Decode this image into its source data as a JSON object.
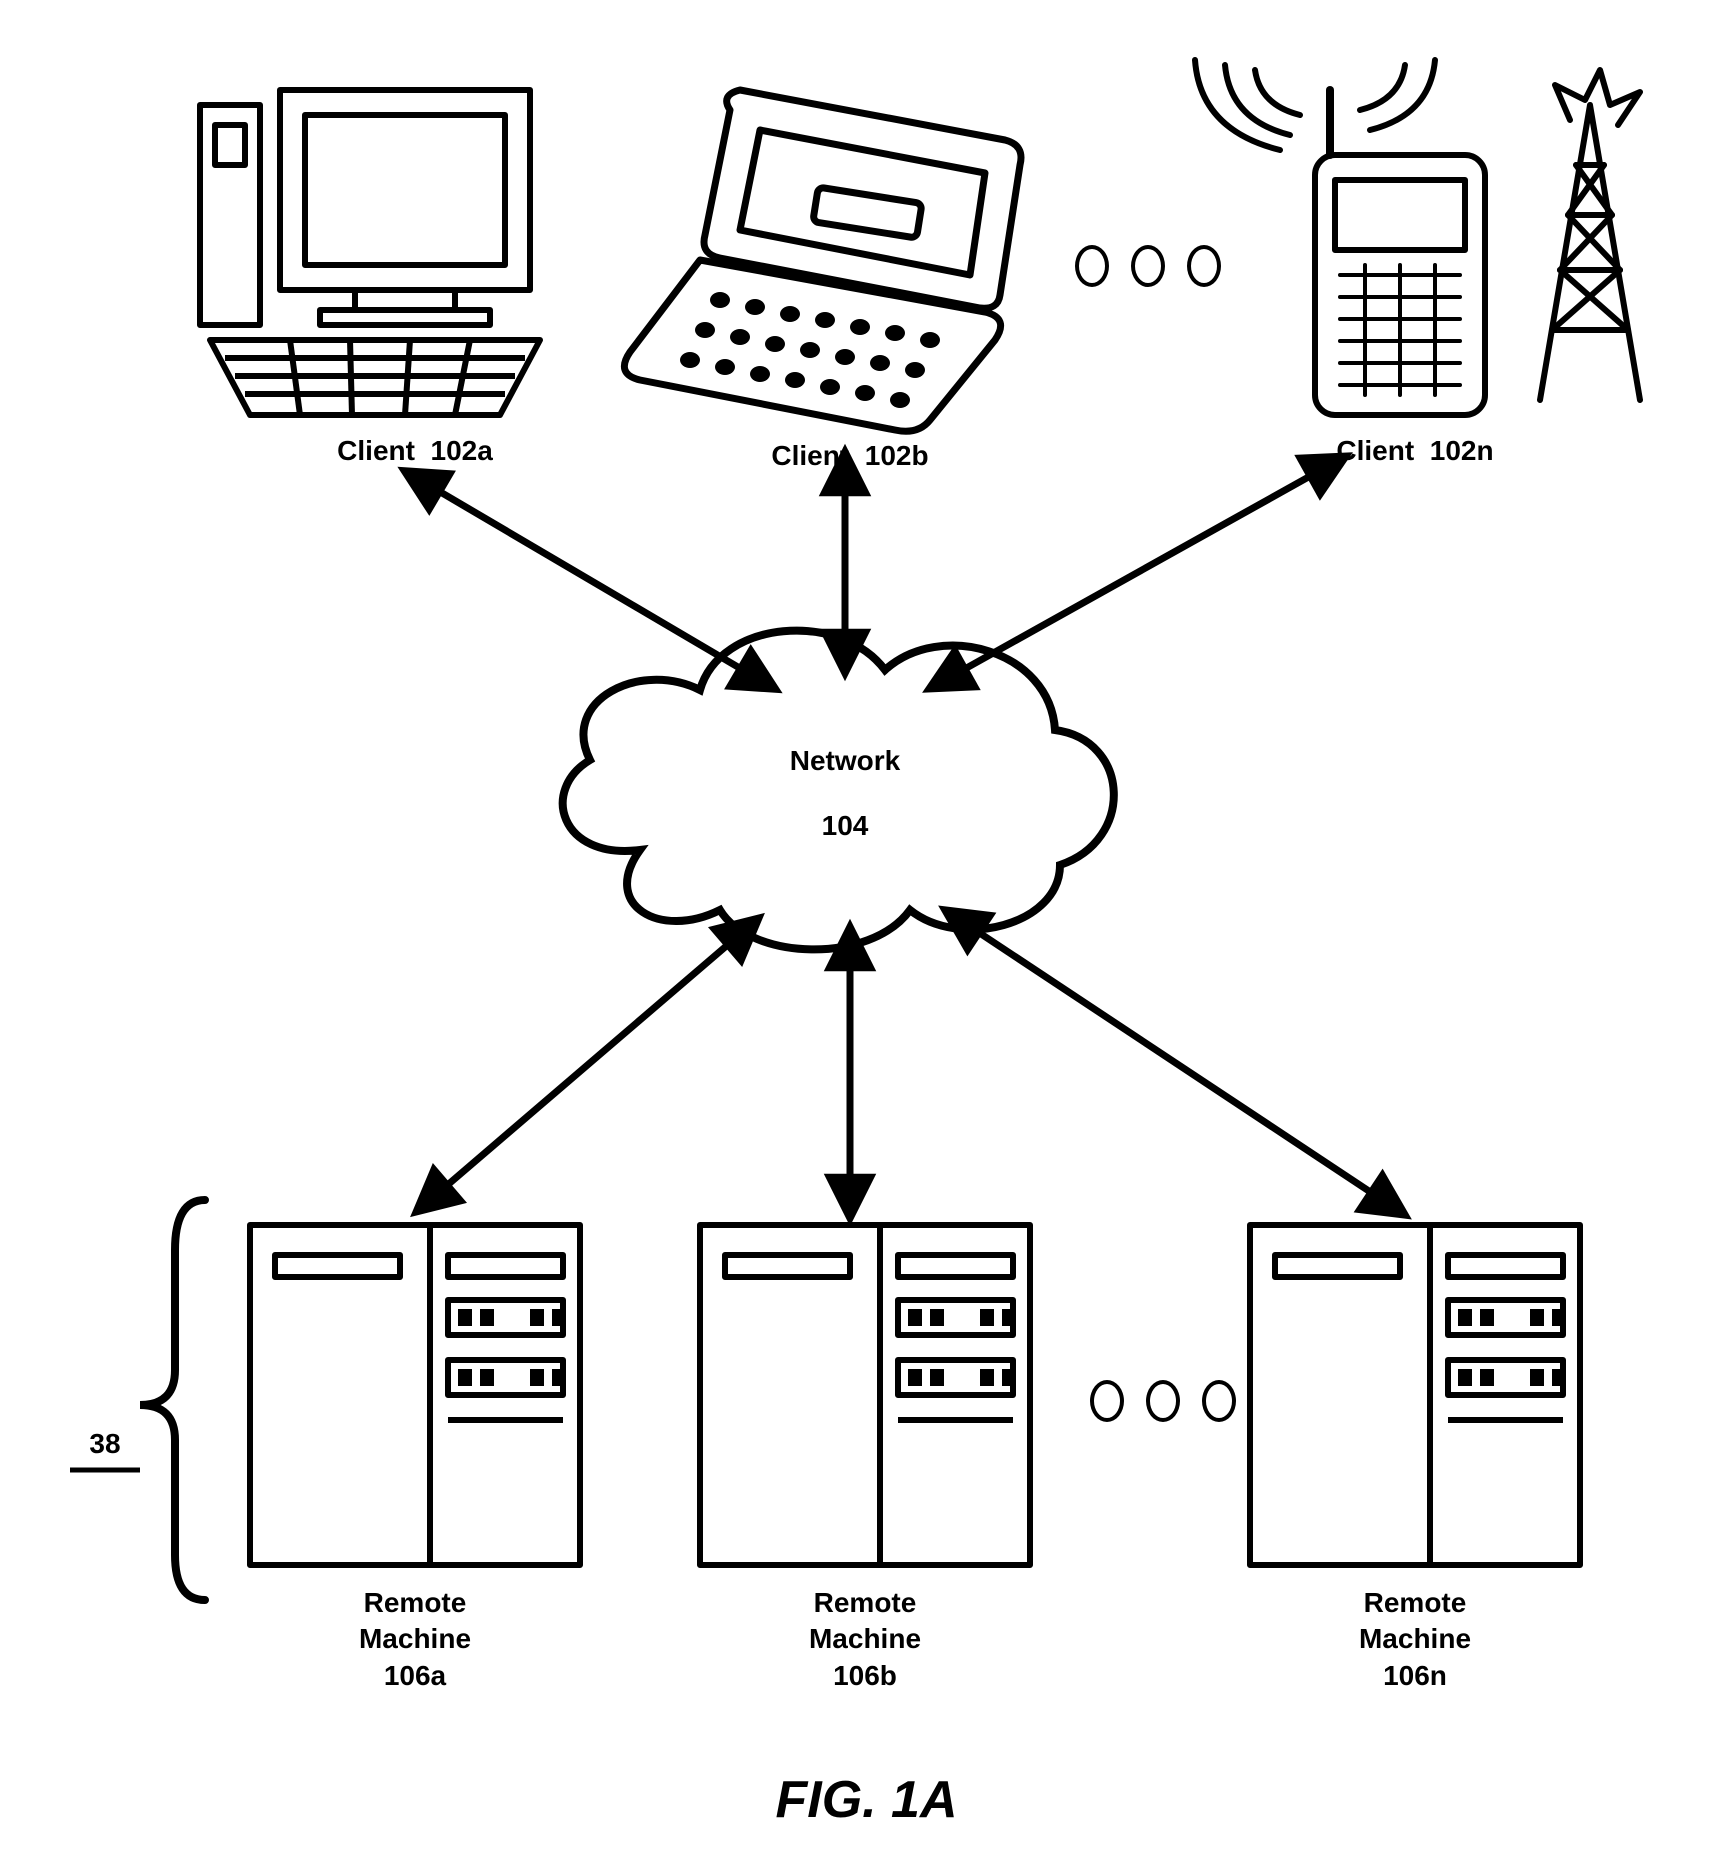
{
  "figure_label": "FIG. 1A",
  "network": {
    "label": "Network",
    "id": "104"
  },
  "clients": [
    {
      "type": "desktop",
      "label": "Client",
      "id": "102a"
    },
    {
      "type": "laptop",
      "label": "Client",
      "id": "102b"
    },
    {
      "type": "mobile",
      "label": "Client",
      "id": "102n"
    }
  ],
  "servers_group_id": "38",
  "servers": [
    {
      "label_line1": "Remote",
      "label_line2": "Machine",
      "id": "106a"
    },
    {
      "label_line1": "Remote",
      "label_line2": "Machine",
      "id": "106b"
    },
    {
      "label_line1": "Remote",
      "label_line2": "Machine",
      "id": "106n"
    }
  ]
}
